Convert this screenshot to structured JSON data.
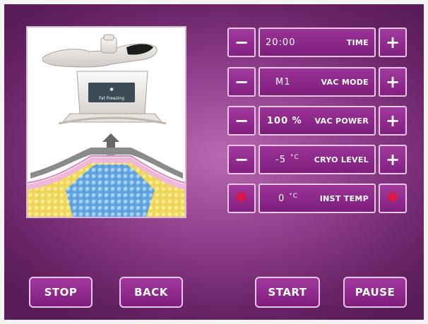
{
  "controls": [
    {
      "value": "20:00",
      "label": "TIME",
      "left": "−",
      "right": "+"
    },
    {
      "value": "M1",
      "label": "VAC MODE",
      "left": "−",
      "right": "+"
    },
    {
      "value": "100 %",
      "label": "VAC POWER",
      "left": "−",
      "right": "+"
    },
    {
      "value": "-5",
      "unit": "°C",
      "label": "CRYO LEVEL",
      "left": "−",
      "right": "+"
    },
    {
      "value": "0",
      "unit": "°C",
      "label": "INST TEMP",
      "left": "✱",
      "right": "✱"
    }
  ],
  "device_label": "Fat Freezing",
  "buttons": {
    "stop": "STOP",
    "back": "BACK",
    "start": "START",
    "pause": "PAUSE"
  },
  "colors": {
    "accent": "#8f2a8b",
    "snowflake": "#e0173a"
  }
}
